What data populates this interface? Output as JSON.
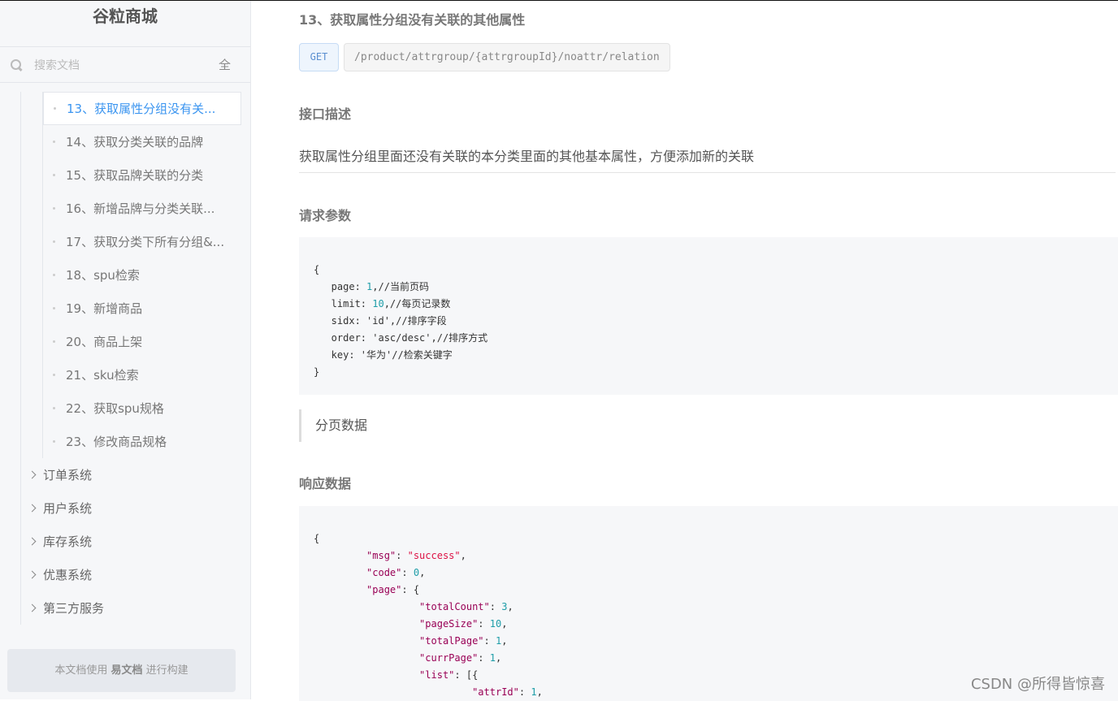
{
  "sidebar": {
    "brand": "谷粒商城",
    "search_placeholder": "搜索文档",
    "search_all": "全",
    "sub_items": [
      "13、获取属性分组没有关...",
      "14、获取分类关联的品牌",
      "15、获取品牌关联的分类",
      "16、新增品牌与分类关联...",
      "17、获取分类下所有分组&...",
      "18、spu检索",
      "19、新增商品",
      "20、商品上架",
      "21、sku检索",
      "22、获取spu规格",
      "23、修改商品规格"
    ],
    "top_items": [
      "订单系统",
      "用户系统",
      "库存系统",
      "优惠系统",
      "第三方服务"
    ],
    "footer": {
      "pre": "本文档使用",
      "brand": "易文档",
      "post": "进行构建"
    }
  },
  "main": {
    "title": "13、获取属性分组没有关联的其他属性",
    "method": "GET",
    "path": "/product/attrgroup/{attrgroupId}/noattr/relation",
    "desc_heading": "接口描述",
    "description": "获取属性分组里面还没有关联的本分类里面的其他基本属性，方便添加新的关联",
    "params_heading": "请求参数",
    "params_code": [
      [
        [
          "{",
          ""
        ]
      ],
      [
        [
          "   page: ",
          ""
        ],
        [
          "1",
          "n"
        ],
        [
          ",//当前页码",
          ""
        ]
      ],
      [
        [
          "   limit: ",
          ""
        ],
        [
          "10",
          "n"
        ],
        [
          ",//每页记录数",
          ""
        ]
      ],
      [
        [
          "   sidx: 'id',//排序字段",
          ""
        ]
      ],
      [
        [
          "   order: 'asc/desc',//排序方式",
          ""
        ]
      ],
      [
        [
          "   key: '华为'//检索关键字",
          ""
        ]
      ],
      [
        [
          "}",
          ""
        ]
      ]
    ],
    "quote": "分页数据",
    "response_heading": "响应数据",
    "response_code": [
      [
        [
          "{",
          ""
        ]
      ],
      [
        [
          "         ",
          ""
        ],
        [
          "\"msg\"",
          "k"
        ],
        [
          ": ",
          ""
        ],
        [
          "\"success\"",
          "s"
        ],
        [
          ",",
          ""
        ]
      ],
      [
        [
          "         ",
          ""
        ],
        [
          "\"code\"",
          "k"
        ],
        [
          ": ",
          ""
        ],
        [
          "0",
          "n"
        ],
        [
          ",",
          ""
        ]
      ],
      [
        [
          "         ",
          ""
        ],
        [
          "\"page\"",
          "k"
        ],
        [
          ": {",
          ""
        ]
      ],
      [
        [
          "                  ",
          ""
        ],
        [
          "\"totalCount\"",
          "k"
        ],
        [
          ": ",
          ""
        ],
        [
          "3",
          "n"
        ],
        [
          ",",
          ""
        ]
      ],
      [
        [
          "                  ",
          ""
        ],
        [
          "\"pageSize\"",
          "k"
        ],
        [
          ": ",
          ""
        ],
        [
          "10",
          "n"
        ],
        [
          ",",
          ""
        ]
      ],
      [
        [
          "                  ",
          ""
        ],
        [
          "\"totalPage\"",
          "k"
        ],
        [
          ": ",
          ""
        ],
        [
          "1",
          "n"
        ],
        [
          ",",
          ""
        ]
      ],
      [
        [
          "                  ",
          ""
        ],
        [
          "\"currPage\"",
          "k"
        ],
        [
          ": ",
          ""
        ],
        [
          "1",
          "n"
        ],
        [
          ",",
          ""
        ]
      ],
      [
        [
          "                  ",
          ""
        ],
        [
          "\"list\"",
          "k"
        ],
        [
          ": [{",
          ""
        ]
      ],
      [
        [
          "                           ",
          ""
        ],
        [
          "\"attrId\"",
          "k"
        ],
        [
          ": ",
          ""
        ],
        [
          "1",
          "n"
        ],
        [
          ",",
          ""
        ]
      ]
    ]
  },
  "watermark": "CSDN @所得皆惊喜"
}
